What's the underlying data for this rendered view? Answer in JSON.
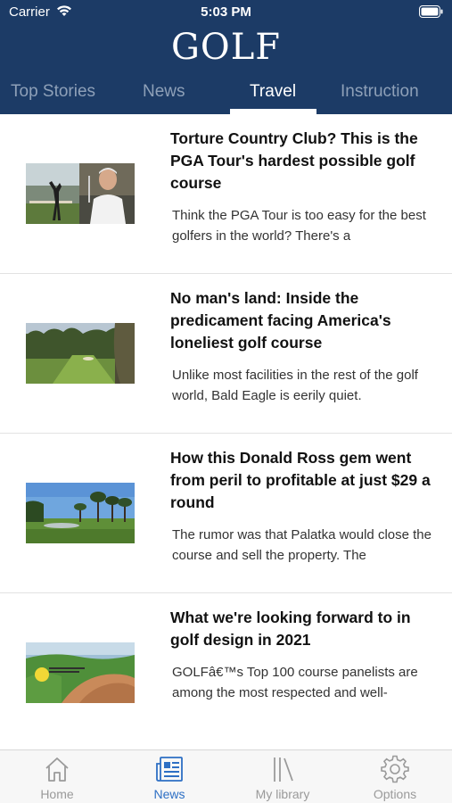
{
  "status": {
    "carrier": "Carrier",
    "time": "5:03 PM"
  },
  "header": {
    "logo": "GOLF"
  },
  "tabs": [
    {
      "label": "Top Stories",
      "active": false
    },
    {
      "label": "News",
      "active": false
    },
    {
      "label": "Travel",
      "active": true
    },
    {
      "label": "Instruction",
      "active": false
    }
  ],
  "articles": [
    {
      "title": "Torture Country Club? This is the PGA Tour's hardest possible golf course",
      "teaser": "Think the PGA Tour is too easy for the best golfers in the world? There's a"
    },
    {
      "title": "No man's land: Inside the predicament facing America's loneliest golf course",
      "teaser": "Unlike most facilities in the rest of the golf world, Bald Eagle is eerily quiet."
    },
    {
      "title": "How this Donald Ross gem went from peril to profitable at just $29 a round",
      "teaser": "The rumor was that Palatka would close the course and sell the property. The"
    },
    {
      "title": "What we're looking forward to in golf design in 2021",
      "teaser": "GOLFâ€™s Top 100 course panelists are among the most respected and well-"
    }
  ],
  "tabbar": [
    {
      "label": "Home",
      "icon": "home-icon",
      "active": false
    },
    {
      "label": "News",
      "icon": "newspaper-icon",
      "active": true
    },
    {
      "label": "My library",
      "icon": "library-icon",
      "active": false
    },
    {
      "label": "Options",
      "icon": "gear-icon",
      "active": false
    }
  ],
  "colors": {
    "header": "#1c3b66",
    "active_tab": "#ffffff",
    "inactive_tab": "#8ea0b8",
    "tabbar_active": "#2d6fc4"
  }
}
